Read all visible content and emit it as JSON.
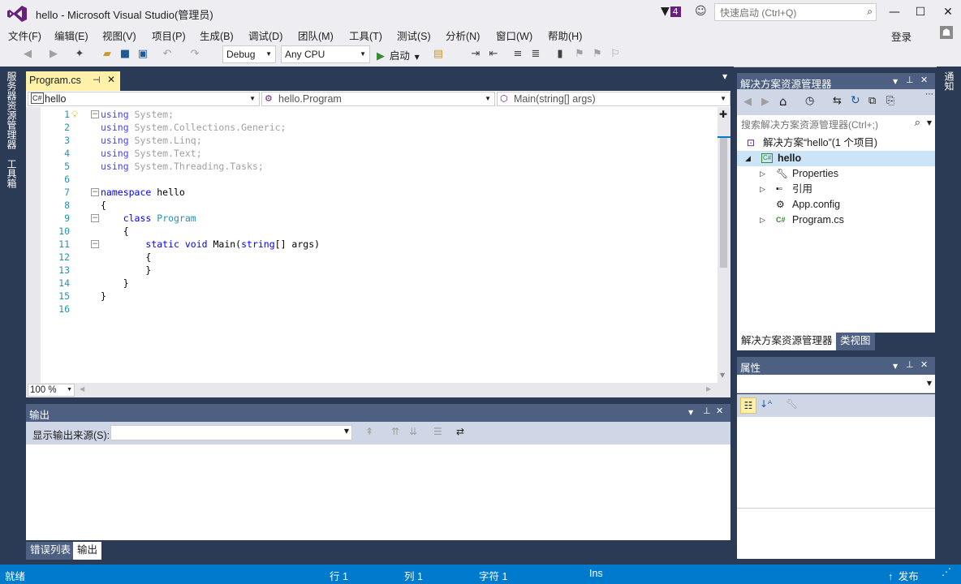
{
  "window": {
    "title": "hello - Microsoft Visual Studio(管理员)",
    "notification_count": "4",
    "quick_launch_placeholder": "快速启动 (Ctrl+Q)",
    "minimize": "—",
    "maximize": "☐",
    "close": "✕",
    "login": "登录"
  },
  "menu": [
    "文件(F)",
    "编辑(E)",
    "视图(V)",
    "项目(P)",
    "生成(B)",
    "调试(D)",
    "团队(M)",
    "工具(T)",
    "测试(S)",
    "分析(N)",
    "窗口(W)",
    "帮助(H)"
  ],
  "toolbar": {
    "config": "Debug",
    "platform": "Any CPU",
    "start_label": "启动"
  },
  "left_tabs": [
    "服务器资源管理器",
    "工具箱"
  ],
  "right_tabs": [
    "通知"
  ],
  "editor": {
    "tab_label": "Program.cs",
    "nav_project": "hello",
    "nav_class": "hello.Program",
    "nav_member": "Main(string[] args)",
    "zoom": "100 %",
    "line_numbers": [
      "1",
      "2",
      "3",
      "4",
      "5",
      "6",
      "7",
      "8",
      "9",
      "10",
      "11",
      "12",
      "13",
      "14",
      "15",
      "16"
    ],
    "lines": [
      {
        "indent": "",
        "kw": "using",
        "rest": " System;",
        "dim": true
      },
      {
        "indent": "",
        "kw": "using",
        "rest": " System.Collections.Generic;",
        "dim": true
      },
      {
        "indent": "",
        "kw": "using",
        "rest": " System.Linq;",
        "dim": true
      },
      {
        "indent": "",
        "kw": "using",
        "rest": " System.Text;",
        "dim": true
      },
      {
        "indent": "",
        "kw": "using",
        "rest": " System.Threading.Tasks;",
        "dim": true
      },
      {
        "indent": "",
        "kw": "",
        "rest": ""
      },
      {
        "indent": "",
        "kw": "namespace",
        "rest": " hello"
      },
      {
        "indent": "",
        "kw": "",
        "rest": "{"
      },
      {
        "indent": "    ",
        "kw": "class",
        "rest": " ",
        "cls": "Program"
      },
      {
        "indent": "    ",
        "kw": "",
        "rest": "{"
      },
      {
        "indent": "        ",
        "kw": "static void",
        "rest": " Main(",
        "kw2": "string",
        "rest2": "[] args)"
      },
      {
        "indent": "        ",
        "kw": "",
        "rest": "{"
      },
      {
        "indent": "        ",
        "kw": "",
        "rest": "}"
      },
      {
        "indent": "    ",
        "kw": "",
        "rest": "}"
      },
      {
        "indent": "",
        "kw": "",
        "rest": "}"
      },
      {
        "indent": "",
        "kw": "",
        "rest": ""
      }
    ]
  },
  "output": {
    "title": "输出",
    "source_label": "显示输出来源(S):",
    "source_value": ""
  },
  "bottom_tabs": [
    "错误列表",
    "输出"
  ],
  "solution_explorer": {
    "title": "解决方案资源管理器",
    "search_placeholder": "搜索解决方案资源管理器(Ctrl+;)",
    "items": [
      {
        "label": "解决方案“hello”(1 个项目)",
        "level": 0
      },
      {
        "label": "hello",
        "level": 1,
        "bold": true
      },
      {
        "label": "Properties",
        "level": 2
      },
      {
        "label": "引用",
        "level": 2
      },
      {
        "label": "App.config",
        "level": 2
      },
      {
        "label": "Program.cs",
        "level": 2
      }
    ],
    "tabs": [
      "解决方案资源管理器",
      "类视图"
    ]
  },
  "properties": {
    "title": "属性"
  },
  "status": {
    "ready": "就绪",
    "row": "行 1",
    "col": "列 1",
    "char": "字符 1",
    "mode": "Ins",
    "publish": "发布"
  },
  "colors": {
    "accent": "#007acc",
    "frame": "#2b3a55",
    "panel_header": "#4d6082",
    "vs_purple": "#68217a"
  }
}
